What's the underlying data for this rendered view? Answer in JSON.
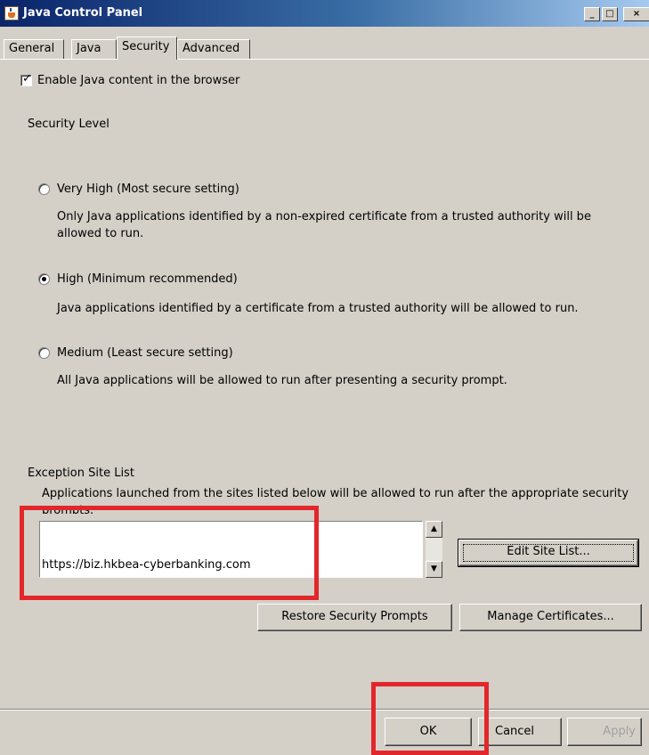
{
  "window": {
    "title": "Java Control Panel",
    "controls": {
      "minimize": "_",
      "maximize": "□",
      "close": "×"
    }
  },
  "tabs": [
    {
      "label": "General",
      "active": false
    },
    {
      "label": "Java",
      "active": false
    },
    {
      "label": "Security",
      "active": true
    },
    {
      "label": "Advanced",
      "active": false
    }
  ],
  "security": {
    "enable_java_label": "Enable Java content in the browser",
    "enable_java_checked": true,
    "security_level_heading": "Security Level",
    "levels": [
      {
        "label": "Very High (Most secure setting)",
        "description": "Only Java applications identified by a non-expired certificate from a trusted authority will be allowed to run.",
        "selected": false
      },
      {
        "label": "High (Minimum recommended)",
        "description": "Java applications identified by a certificate from a trusted authority will be allowed to run.",
        "selected": true
      },
      {
        "label": "Medium (Least secure setting)",
        "description": "All Java applications will be allowed to run after presenting a security prompt.",
        "selected": false
      }
    ],
    "exception_heading": "Exception Site List",
    "exception_description": "Applications launched from the sites listed below will be allowed to run after the appropriate security prompts.",
    "site_list": [
      "https://biz.hkbea-cyberbanking.com"
    ],
    "edit_site_list_label": "Edit Site List...",
    "restore_prompts_label": "Restore Security Prompts",
    "manage_certificates_label": "Manage Certificates..."
  },
  "footer": {
    "ok_label": "OK",
    "cancel_label": "Cancel",
    "apply_label": "Apply"
  },
  "annotations": {
    "highlight_color": "#e3262b"
  },
  "icons": {
    "app": "java-cup-icon",
    "scroll_up": "scroll-up-arrow-icon",
    "scroll_down": "scroll-down-arrow-icon",
    "checkmark": "checkmark-icon"
  }
}
